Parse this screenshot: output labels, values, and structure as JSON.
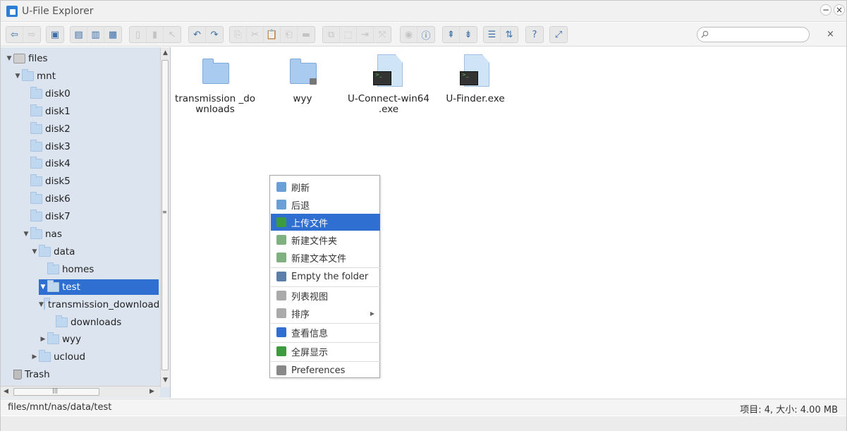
{
  "window": {
    "title": "U-File Explorer",
    "minimize_symbol": "−",
    "close_symbol": "×"
  },
  "toolbar": {
    "groups": [
      {
        "buttons": [
          {
            "icon": "back-icon",
            "glyph": "⇦"
          },
          {
            "icon": "forward-icon",
            "glyph": "⇨",
            "disabled": true
          }
        ]
      },
      {
        "buttons": [
          {
            "icon": "network-drive-icon",
            "glyph": "▣"
          }
        ]
      },
      {
        "buttons": [
          {
            "icon": "new-folder-icon",
            "glyph": "▤"
          },
          {
            "icon": "new-file-icon",
            "glyph": "▥"
          },
          {
            "icon": "upload-icon",
            "glyph": "▦"
          }
        ]
      },
      {
        "buttons": [
          {
            "icon": "open-icon",
            "glyph": "▯",
            "disabled": true
          },
          {
            "icon": "download-icon",
            "glyph": "▮",
            "disabled": true
          },
          {
            "icon": "select-icon",
            "glyph": "↖",
            "disabled": true
          }
        ]
      },
      {
        "buttons": [
          {
            "icon": "undo-icon",
            "glyph": "↶"
          },
          {
            "icon": "redo-icon",
            "glyph": "↷"
          }
        ]
      },
      {
        "buttons": [
          {
            "icon": "copy-icon",
            "glyph": "⎘",
            "disabled": true
          },
          {
            "icon": "cut-icon",
            "glyph": "✂",
            "disabled": true
          },
          {
            "icon": "paste-icon",
            "glyph": "📋",
            "disabled": true
          },
          {
            "icon": "copy-to-icon",
            "glyph": "⎗",
            "disabled": true
          },
          {
            "icon": "delete-icon",
            "glyph": "▬",
            "disabled": true
          }
        ]
      },
      {
        "buttons": [
          {
            "icon": "duplicate-icon",
            "glyph": "⧉",
            "disabled": true
          },
          {
            "icon": "select-all-icon",
            "glyph": "⬚",
            "disabled": true
          },
          {
            "icon": "extract-icon",
            "glyph": "⇥",
            "disabled": true
          },
          {
            "icon": "resize-icon",
            "glyph": "⤧",
            "disabled": true
          }
        ]
      },
      {
        "buttons": [
          {
            "icon": "preview-icon",
            "glyph": "◉",
            "disabled": true
          },
          {
            "icon": "info-icon",
            "glyph": "ⓘ"
          }
        ]
      },
      {
        "buttons": [
          {
            "icon": "sort-up-icon",
            "glyph": "⇞"
          },
          {
            "icon": "sort-down-icon",
            "glyph": "⇟"
          }
        ]
      },
      {
        "buttons": [
          {
            "icon": "list-view-icon",
            "glyph": "☰"
          },
          {
            "icon": "sort-az-icon",
            "glyph": "⇅"
          }
        ]
      },
      {
        "buttons": [
          {
            "icon": "help-icon",
            "glyph": "?"
          }
        ]
      },
      {
        "buttons": [
          {
            "icon": "fullscreen-icon",
            "glyph": "⤢"
          }
        ]
      }
    ],
    "search": {
      "placeholder": "",
      "value": ""
    },
    "search_clear_symbol": "×"
  },
  "tree": [
    {
      "label": "files",
      "depth": 0,
      "arrow": "▼",
      "icon": "disk"
    },
    {
      "label": "mnt",
      "depth": 1,
      "arrow": "▼",
      "icon": "link"
    },
    {
      "label": "disk0",
      "depth": 2,
      "arrow": "",
      "icon": "folder"
    },
    {
      "label": "disk1",
      "depth": 2,
      "arrow": "",
      "icon": "folder"
    },
    {
      "label": "disk2",
      "depth": 2,
      "arrow": "",
      "icon": "folder"
    },
    {
      "label": "disk3",
      "depth": 2,
      "arrow": "",
      "icon": "folder"
    },
    {
      "label": "disk4",
      "depth": 2,
      "arrow": "",
      "icon": "folder"
    },
    {
      "label": "disk5",
      "depth": 2,
      "arrow": "",
      "icon": "folder"
    },
    {
      "label": "disk6",
      "depth": 2,
      "arrow": "",
      "icon": "folder"
    },
    {
      "label": "disk7",
      "depth": 2,
      "arrow": "",
      "icon": "folder"
    },
    {
      "label": "nas",
      "depth": 2,
      "arrow": "▼",
      "icon": "folder"
    },
    {
      "label": "data",
      "depth": 3,
      "arrow": "▼",
      "icon": "folder"
    },
    {
      "label": "homes",
      "depth": 4,
      "arrow": "",
      "icon": "folder"
    },
    {
      "label": "test",
      "depth": 3,
      "arrow": "▼",
      "icon": "folder",
      "selected": true
    },
    {
      "label": "transmission_downloads",
      "depth": 4,
      "arrow": "▼",
      "icon": "folder"
    },
    {
      "label": "downloads",
      "depth": 5,
      "arrow": "",
      "icon": "folder"
    },
    {
      "label": "wyy",
      "depth": 4,
      "arrow": "▶",
      "icon": "folder"
    },
    {
      "label": "ucloud",
      "depth": 3,
      "arrow": "▶",
      "icon": "folder"
    },
    {
      "label": "Trash",
      "depth": 0,
      "arrow": "",
      "icon": "trash"
    }
  ],
  "scroll_arrows": {
    "up": "▲",
    "down": "▼",
    "left": "◀",
    "right": "▶",
    "hgrip": "|||",
    "vgrip": "≡"
  },
  "files": [
    {
      "name": "transmission_downloads",
      "display": "transmission _downloads",
      "type": "folder"
    },
    {
      "name": "wyy",
      "display": "wyy",
      "type": "folder-locked"
    },
    {
      "name": "U-Connect-win64.exe",
      "display": "U-Connect-win64 .exe",
      "type": "exe"
    },
    {
      "name": "U-Finder.exe",
      "display": "U-Finder.exe",
      "type": "exe"
    }
  ],
  "terminal_glyph": ">_",
  "context_menu": {
    "items": [
      {
        "label": "刷新",
        "icon": "refresh-icon",
        "color": "#6b9fd8"
      },
      {
        "label": "后退",
        "icon": "back-icon",
        "color": "#6b9fd8"
      },
      {
        "label": "上传文件",
        "icon": "upload-icon",
        "color": "#3c9b3c",
        "active": true
      },
      {
        "label": "新建文件夹",
        "icon": "new-folder-icon",
        "color": "#7fb07f"
      },
      {
        "label": "新建文本文件",
        "icon": "new-text-file-icon",
        "color": "#7fb07f"
      },
      {
        "sep": true
      },
      {
        "label": "Empty the folder",
        "icon": "empty-folder-icon",
        "color": "#5b7fa8"
      },
      {
        "sep": true
      },
      {
        "label": "列表视图",
        "icon": "list-view-icon",
        "color": "#aaaaaa"
      },
      {
        "label": "排序",
        "icon": "sort-icon",
        "color": "#aaaaaa",
        "submenu": true
      },
      {
        "sep": true
      },
      {
        "label": "查看信息",
        "icon": "info-icon",
        "color": "#2f6fd1"
      },
      {
        "sep": true
      },
      {
        "label": "全屏显示",
        "icon": "fullscreen-icon",
        "color": "#3c9b3c"
      },
      {
        "sep": true
      },
      {
        "label": "Preferences",
        "icon": "gear-icon",
        "color": "#888888"
      }
    ],
    "submenu_arrow": "▶"
  },
  "status": {
    "path": "files/mnt/nas/data/test",
    "info": "项目: 4, 大小: 4.00 MB"
  }
}
